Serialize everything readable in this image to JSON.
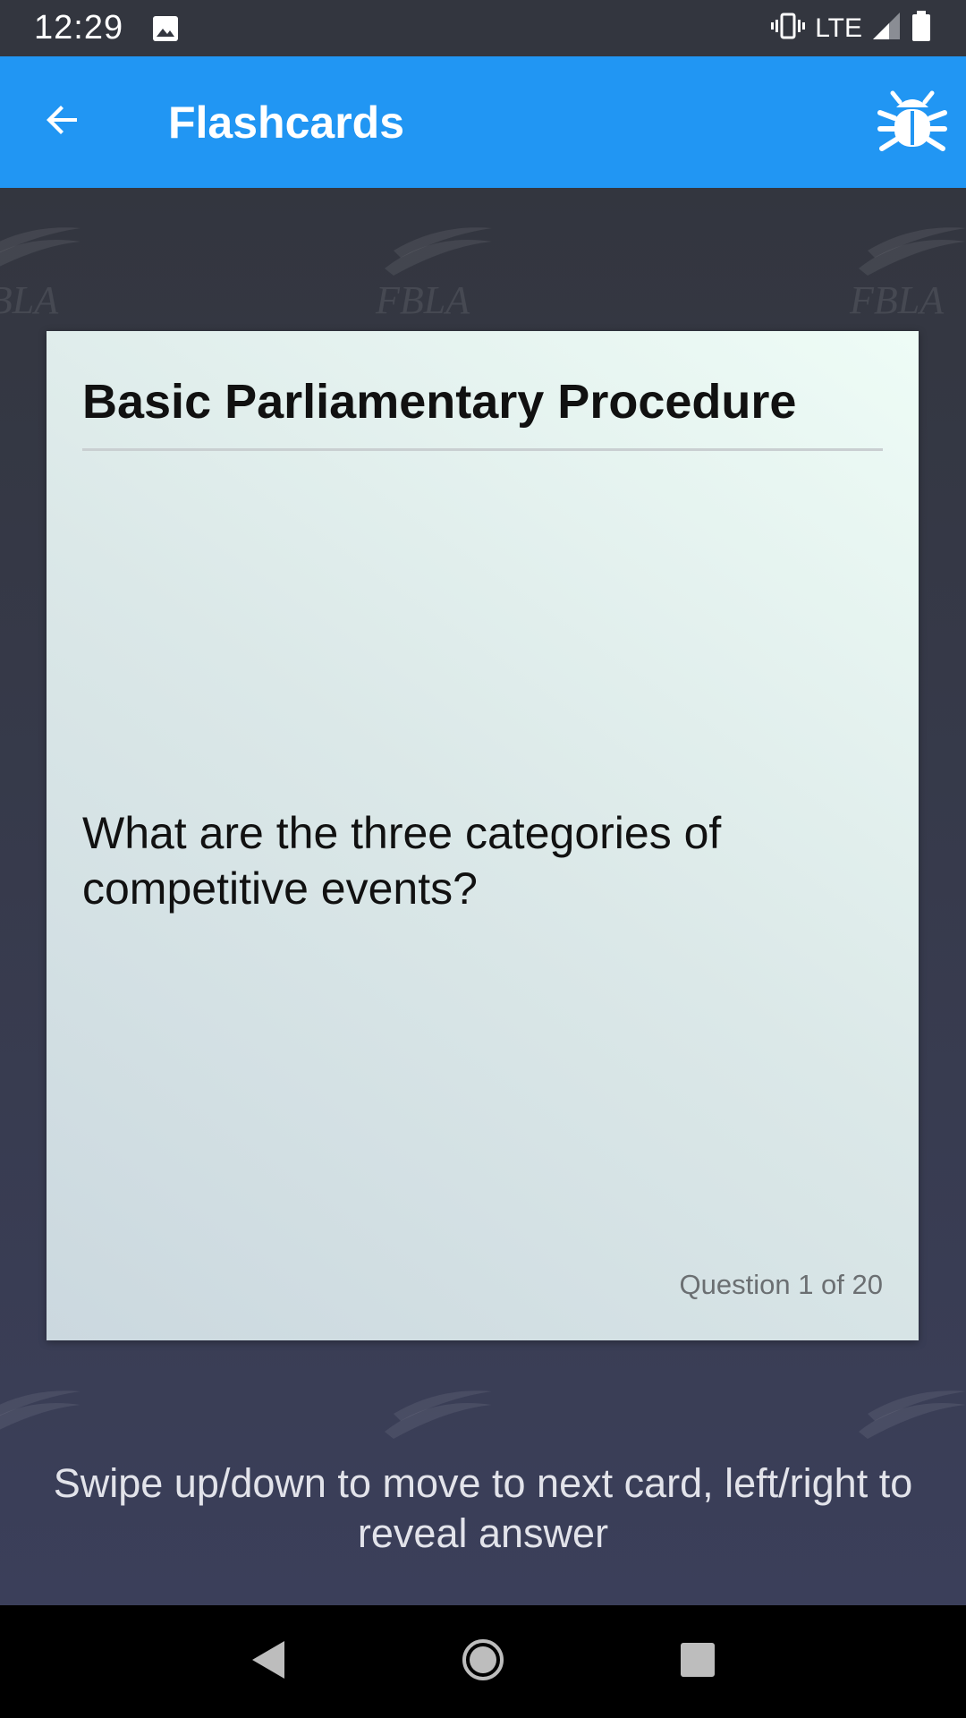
{
  "status_bar": {
    "time": "12:29",
    "network": "LTE",
    "icons": [
      "image-icon",
      "vibrate-icon",
      "signal-icon",
      "battery-icon"
    ]
  },
  "app_bar": {
    "title": "Flashcards",
    "back_icon": "arrow-back-icon",
    "action_icon": "bug-icon",
    "color": "#2196f3"
  },
  "background": {
    "watermark_text": "FBLA"
  },
  "card": {
    "title": "Basic Parliamentary Procedure",
    "question": "What are the three categories of competitive events?",
    "counter": "Question 1 of 20"
  },
  "hint": {
    "text": "Swipe up/down to move to next card, left/right to reveal answer"
  },
  "nav_bar": {
    "icons": [
      "back-triangle-icon",
      "home-circle-icon",
      "recents-square-icon"
    ]
  }
}
